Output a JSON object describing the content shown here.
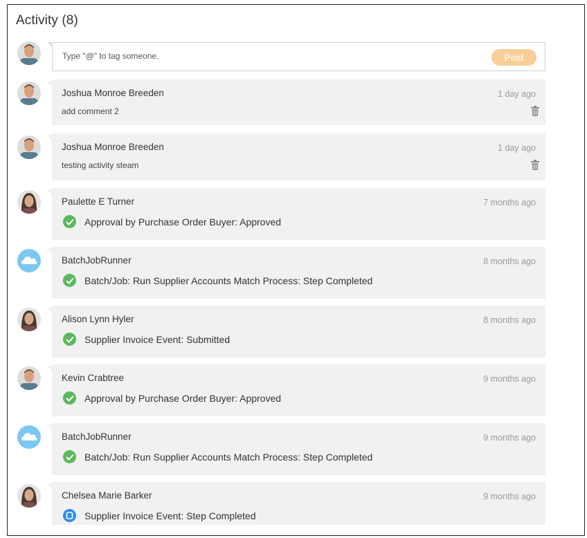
{
  "header": {
    "title": "Activity (8)"
  },
  "compose": {
    "placeholder": "Type \"@\" to tag someone.",
    "post_label": "Post"
  },
  "colors": {
    "post_button": "#f8cf99",
    "card_bg": "#f1f1f1",
    "success_green": "#5cb85c",
    "step_blue": "#2f8ee8",
    "cloud_blue": "#79c7f2"
  },
  "activities": [
    {
      "name": "Joshua Monroe Breeden",
      "time": "1 day ago",
      "text": "add comment 2",
      "type": "comment",
      "avatar": "man-avatar"
    },
    {
      "name": "Joshua Monroe Breeden",
      "time": "1 day ago",
      "text": "testing activity steam",
      "type": "comment",
      "avatar": "man-avatar"
    },
    {
      "name": "Paulette E Turner",
      "time": "7 months ago",
      "text": "Approval by Purchase Order Buyer: Approved",
      "type": "event",
      "icon": "check-circle-icon",
      "avatar": "woman-avatar"
    },
    {
      "name": "BatchJobRunner",
      "time": "8 months ago",
      "text": "Batch/Job: Run Supplier Accounts Match Process: Step Completed",
      "type": "event",
      "icon": "check-circle-icon",
      "avatar": "cloud-avatar"
    },
    {
      "name": "Alison Lynn Hyler",
      "time": "8 months ago",
      "text": "Supplier Invoice Event: Submitted",
      "type": "event",
      "icon": "check-circle-icon",
      "avatar": "woman-avatar"
    },
    {
      "name": "Kevin Crabtree",
      "time": "9 months ago",
      "text": "Approval by Purchase Order Buyer: Approved",
      "type": "event",
      "icon": "check-circle-icon",
      "avatar": "man-avatar"
    },
    {
      "name": "BatchJobRunner",
      "time": "9 months ago",
      "text": "Batch/Job: Run Supplier Accounts Match Process: Step Completed",
      "type": "event",
      "icon": "check-circle-icon",
      "avatar": "cloud-avatar"
    },
    {
      "name": "Chelsea Marie Barker",
      "time": "9 months ago",
      "text": "Supplier Invoice Event: Step Completed",
      "type": "event",
      "icon": "step-icon",
      "avatar": "woman-avatar"
    }
  ]
}
